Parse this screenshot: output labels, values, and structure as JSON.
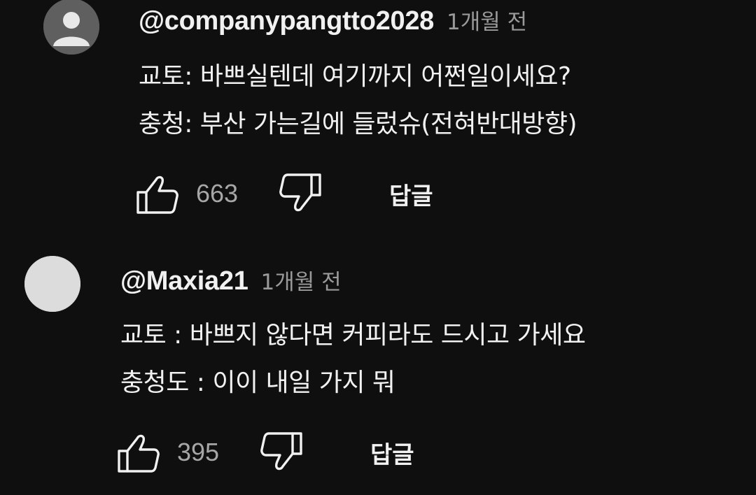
{
  "comments": [
    {
      "handle": "@companypangtto2028",
      "time": "1개월 전",
      "lines": [
        "교토: 바쁘실텐데 여기까지 어쩐일이세요?",
        "충청: 부산 가는길에 들렀슈(전혀반대방향)"
      ],
      "likes": "663",
      "reply_label": "답글",
      "avatar": "default-person-avatar",
      "like_icon": "thumbs-up-icon",
      "dislike_icon": "thumbs-down-icon"
    },
    {
      "handle": "@Maxia21",
      "time": "1개월 전",
      "lines": [
        "교토 : 바쁘지 않다면 커피라도 드시고 가세요",
        "충청도 : 이이 내일 가지 뭐"
      ],
      "likes": "395",
      "reply_label": "답글",
      "avatar": "light-avatar",
      "like_icon": "thumbs-up-icon",
      "dislike_icon": "thumbs-down-icon"
    }
  ],
  "colors": {
    "background": "#0f0f0f",
    "text": "#f1f1f1",
    "secondary_text": "#9a9a9a",
    "count_text": "#a7a7a7"
  }
}
